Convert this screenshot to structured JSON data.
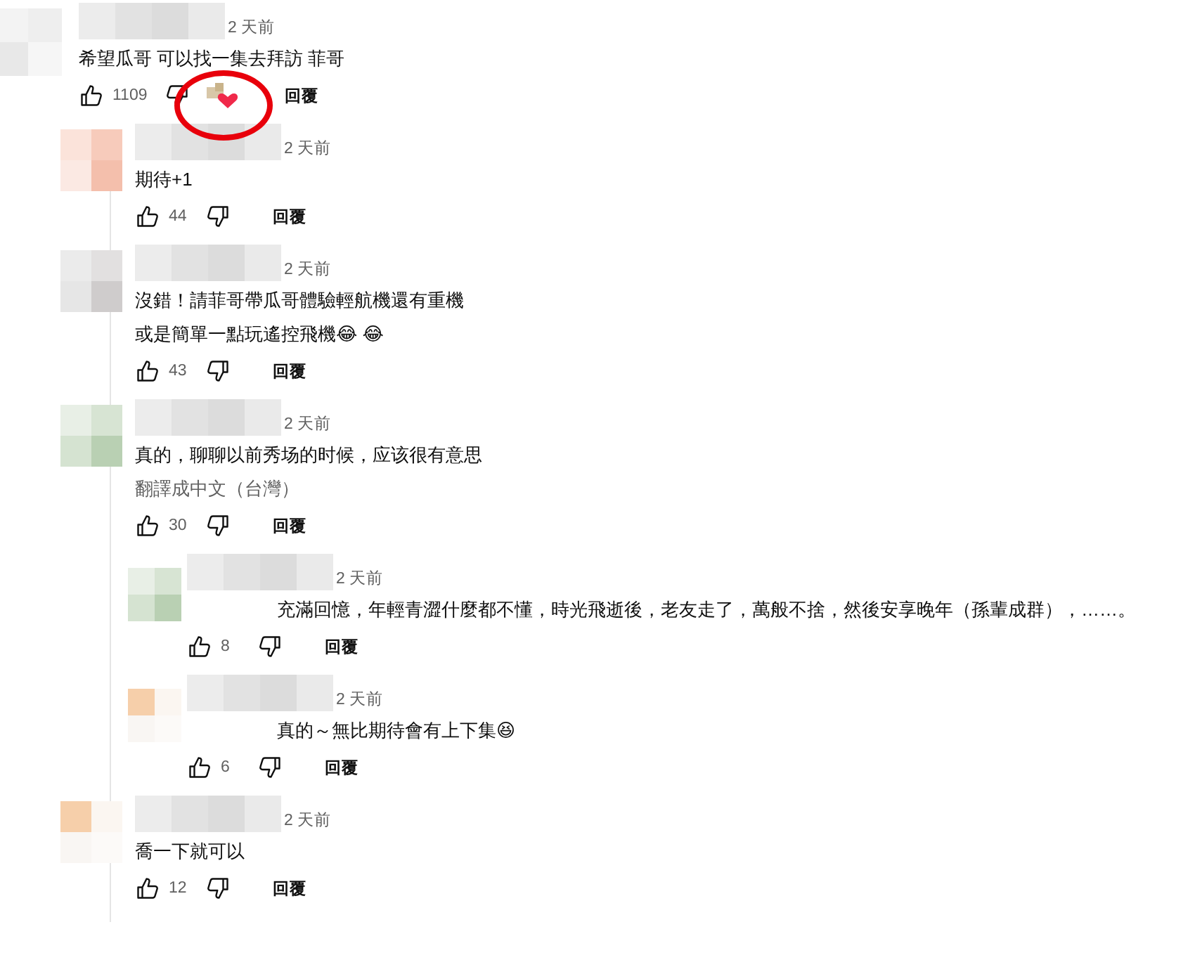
{
  "comments": [
    {
      "time": "2 天前",
      "lines": [
        "希望瓜哥 可以找一集去拜訪 菲哥"
      ],
      "likes": "1109",
      "creator_heart": true,
      "reply": "回覆",
      "children": [
        {
          "time": "2 天前",
          "lines": [
            "期待+1"
          ],
          "likes": "44",
          "reply": "回覆"
        },
        {
          "time": "2 天前",
          "lines": [
            "沒錯！請菲哥帶瓜哥體驗輕航機還有重機",
            "或是簡單一點玩遙控飛機😂 😂"
          ],
          "likes": "43",
          "reply": "回覆"
        },
        {
          "time": "2 天前",
          "lines": [
            "真的，聊聊以前秀场的时候，应该很有意思"
          ],
          "translate": "翻譯成中文（台灣）",
          "likes": "30",
          "reply": "回覆",
          "children": [
            {
              "time": "2 天前",
              "lines": [
                "充滿回憶，年輕青澀什麼都不懂，時光飛逝後，老友走了，萬般不捨，然後安享晚年（孫輩成群），……。"
              ],
              "likes": "8",
              "reply": "回覆"
            },
            {
              "time": "2 天前",
              "lines": [
                "真的～無比期待會有上下集😆"
              ],
              "likes": "6",
              "reply": "回覆"
            }
          ]
        },
        {
          "time": "2 天前",
          "lines": [
            "喬一下就可以"
          ],
          "likes": "12",
          "reply": "回覆"
        }
      ]
    }
  ]
}
